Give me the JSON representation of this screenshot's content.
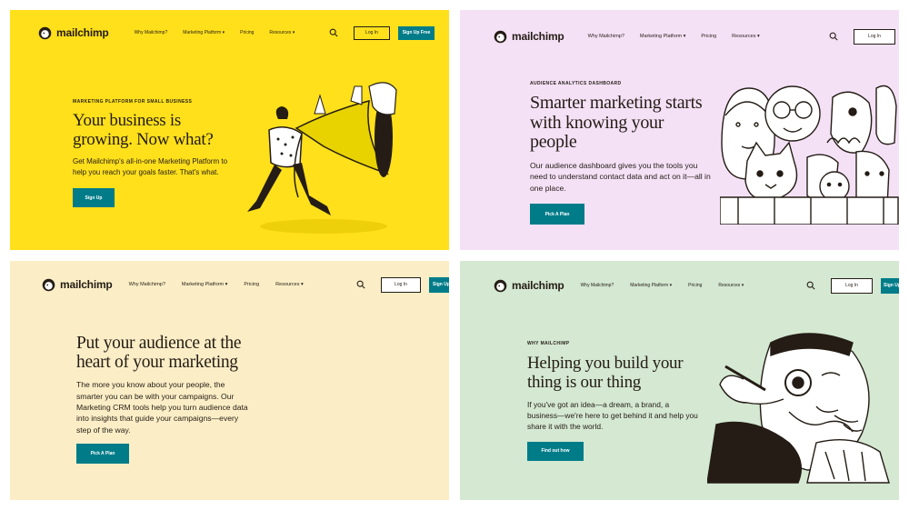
{
  "brand": {
    "name": "mailchimp",
    "teal": "#007c89"
  },
  "panels": [
    {
      "bg": "#ffe01b",
      "nav": {
        "links": [
          "Why Mailchimp?",
          "Marketing Platform ▾",
          "Pricing",
          "Resources ▾"
        ],
        "login": "Log In",
        "signup": "Sign Up Free"
      },
      "eyebrow": "MARKETING PLATFORM FOR SMALL BUSINESS",
      "headline": "Your business is growing. Now what?",
      "body": "Get Mailchimp's all-in-one Marketing Platform to help you reach your goals faster. That's what.",
      "cta": "Sign Up",
      "illustration": "trumpet-player-illustration"
    },
    {
      "bg": "#f4e1f6",
      "nav": {
        "links": [
          "Why Mailchimp?",
          "Marketing Platform ▾",
          "Pricing",
          "Resources ▾"
        ],
        "login": "Log In",
        "signup": ""
      },
      "eyebrow": "AUDIENCE ANALYTICS DASHBOARD",
      "headline": "Smarter marketing starts with knowing your people",
      "body": "Our audience dashboard gives you the tools you need to understand contact data and act on it—all in one place.",
      "cta": "Pick A Plan",
      "illustration": "crowd-faces-illustration"
    },
    {
      "bg": "#fbeec6",
      "nav": {
        "links": [
          "Why Mailchimp?",
          "Marketing Platform ▾",
          "Pricing",
          "Resources ▾"
        ],
        "login": "Log In",
        "signup": "Sign Up"
      },
      "eyebrow": "",
      "headline": "Put your audience at the heart of your marketing",
      "body": "The more you know about your people, the smarter you can be with your campaigns. Our Marketing CRM tools help you turn audience data into insights that guide your campaigns—every step of the way.",
      "cta": "Pick A Plan",
      "illustration": ""
    },
    {
      "bg": "#d4e8d2",
      "nav": {
        "links": [
          "Why Mailchimp?",
          "Marketing Platform ▾",
          "Pricing",
          "Resources ▾"
        ],
        "login": "Log In",
        "signup": "Sign Up"
      },
      "eyebrow": "WHY MAILCHIMP",
      "headline": "Helping you build your thing is our thing",
      "body": "If you've got an idea—a dream, a brand, a business—we're here to get behind it and help you share it with the world.",
      "cta": "Find out how",
      "illustration": "man-with-monocle-illustration"
    }
  ]
}
